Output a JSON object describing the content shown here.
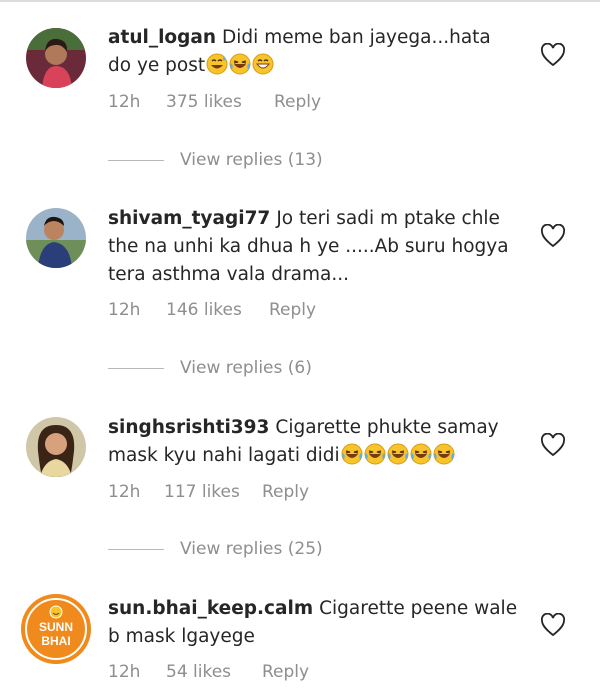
{
  "comments": [
    {
      "username": "atul_logan",
      "text": "Didi meme ban jayega...hata do ye post",
      "emojis": [
        "grinning-sweat",
        "tears-of-joy",
        "grinning"
      ],
      "time": "12h",
      "likes": "375 likes",
      "reply": "Reply",
      "view_replies": "View replies (13)"
    },
    {
      "username": "shivam_tyagi77",
      "text": "Jo teri sadi m ptake chle the na unhi ka dhua h ye .....Ab suru hogya tera asthma vala drama...",
      "emojis": [],
      "time": "12h",
      "likes": "146 likes",
      "reply": "Reply",
      "view_replies": "View replies (6)"
    },
    {
      "username": "singhsrishti393",
      "text": "Cigarette phukte samay mask kyu nahi lagati didi",
      "emojis": [
        "tears-of-joy",
        "tears-of-joy",
        "tears-of-joy",
        "tears-of-joy",
        "tears-of-joy"
      ],
      "time": "12h",
      "likes": "117 likes",
      "reply": "Reply",
      "view_replies": "View replies (25)"
    },
    {
      "username": "sun.bhai_keep.calm",
      "text": "Cigarette peene wale b mask lgayege",
      "emojis": [],
      "time": "12h",
      "likes": "54 likes",
      "reply": "Reply",
      "avatar_logo_text": [
        "SUNN",
        "BHAI"
      ]
    }
  ],
  "colors": {
    "text": "#262626",
    "secondary": "#8e8e8e",
    "logo_orange": "#f08a1c",
    "logo_yellow": "#f7c52b"
  }
}
